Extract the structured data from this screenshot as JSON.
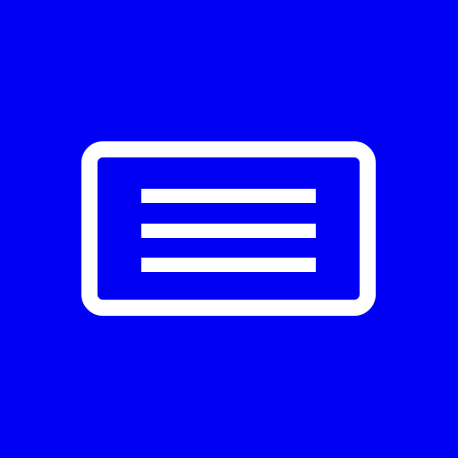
{
  "app_icon": {
    "name": "text-card-icon",
    "background_color": "#0000f5",
    "foreground_color": "#ffffff",
    "line_count": 3
  }
}
